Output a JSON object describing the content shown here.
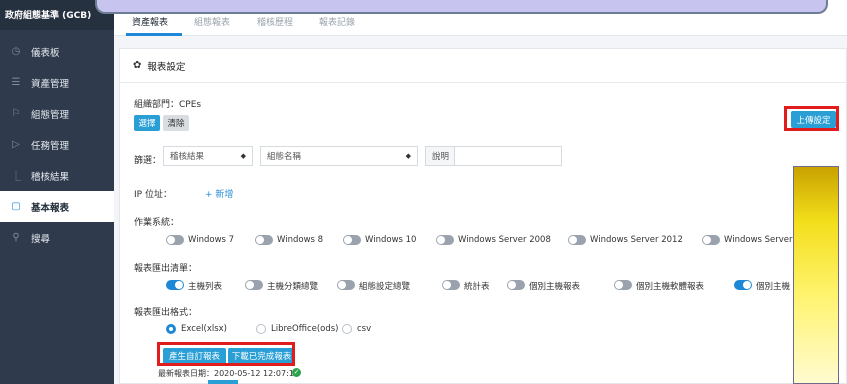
{
  "app": {
    "brand": "政府組態基準 (GCB)"
  },
  "sidebar": {
    "items": [
      {
        "label": "儀表板",
        "icon": "dashboard-icon",
        "glyph": "◷"
      },
      {
        "label": "資產管理",
        "icon": "list-icon",
        "glyph": "☰"
      },
      {
        "label": "組態管理",
        "icon": "flag-icon",
        "glyph": "⚐"
      },
      {
        "label": "任務管理",
        "icon": "play-icon",
        "glyph": "▷"
      },
      {
        "label": "稽核結果",
        "icon": "chart-icon",
        "glyph": "⎿"
      },
      {
        "label": "基本報表",
        "icon": "document-icon",
        "glyph": "▢"
      },
      {
        "label": "搜尋",
        "icon": "search-icon",
        "glyph": "⚲"
      }
    ]
  },
  "tabs": [
    "資產報表",
    "組態報表",
    "稽核歷程",
    "報表記錄"
  ],
  "card": {
    "title": "報表設定"
  },
  "org": {
    "label": "組織部門：CPEs",
    "select_btn": "選擇",
    "clear_btn": "清除",
    "upload_btn": "上傳設定"
  },
  "filter": {
    "label": "篩選：",
    "select1": "稽核結果",
    "select2": "組態名稱",
    "keyword_label": "說明"
  },
  "ip": {
    "label": "IP 位址：",
    "add_link": "+ 新增"
  },
  "os": {
    "label": "作業系統：",
    "options": [
      "Windows 7",
      "Windows 8",
      "Windows 10",
      "Windows Server 2008",
      "Windows Server 2012",
      "Windows Server"
    ]
  },
  "export_list": {
    "label": "報表匯出清單：",
    "options": [
      {
        "label": "主機列表",
        "on": true
      },
      {
        "label": "主機分類總覽",
        "on": false
      },
      {
        "label": "組態設定總覽",
        "on": false
      },
      {
        "label": "統計表",
        "on": false
      },
      {
        "label": "個別主機報表",
        "on": false
      },
      {
        "label": "個別主機軟體報表",
        "on": false
      },
      {
        "label": "個別主機",
        "on": true
      }
    ]
  },
  "export_format": {
    "label": "報表匯出格式：",
    "options": [
      {
        "label": "Excel(xlsx)",
        "on": true
      },
      {
        "label": "LibreOffice(ods)",
        "on": false
      },
      {
        "label": "csv",
        "on": false
      }
    ]
  },
  "actions": {
    "generate_btn": "產生自訂報表",
    "download_btn": "下載已完成報表"
  },
  "latest": {
    "label": "最新報表日期：2020-05-12 12:07:12"
  }
}
